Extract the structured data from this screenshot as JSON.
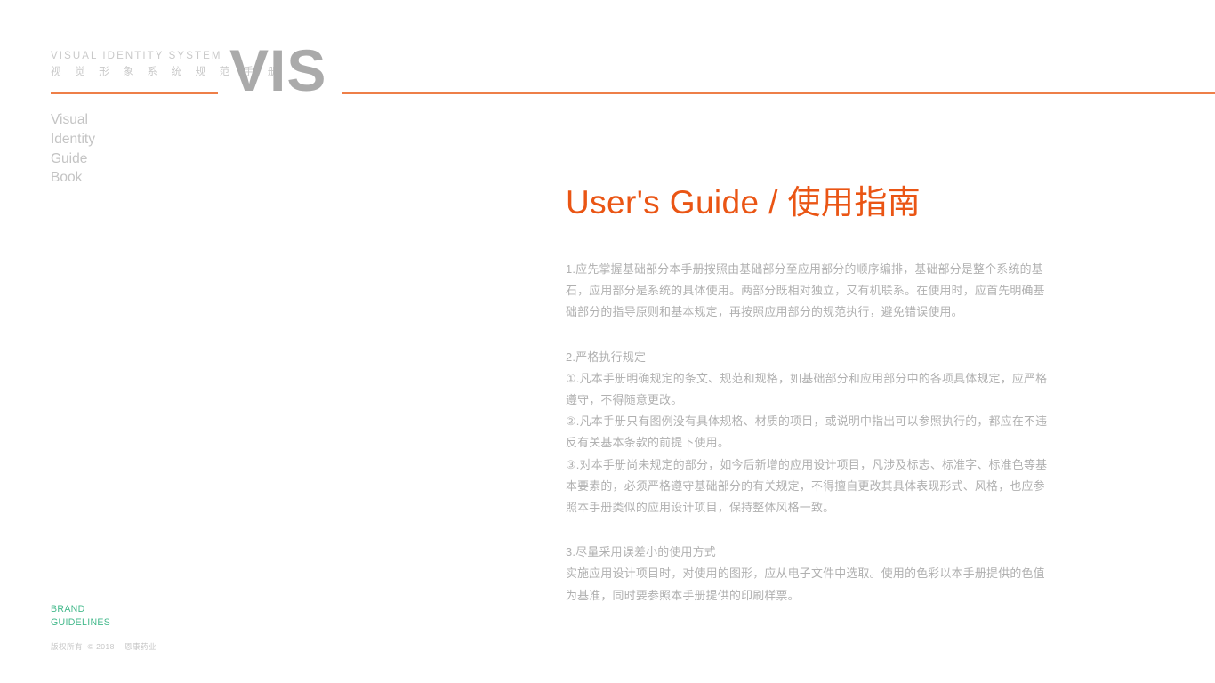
{
  "masthead": {
    "line_en": "VISUAL  IDENTITY  SYSTEM",
    "line_cn": "视 觉 形 象 系 统 规 范 手 册",
    "logo": "VIS",
    "rule_color": "#ee7f48"
  },
  "sidewords": {
    "line1": "Visual",
    "line2": "Identity",
    "line3": "Guide",
    "line4": "Book"
  },
  "main": {
    "title": "User's Guide / 使用指南",
    "title_color": "#ea5514",
    "paragraphs": [
      {
        "id": "p1",
        "lines": [
          "1.应先掌握基础部分本手册按照由基础部分至应用部分的顺序编排，基础部分是整个系统的基",
          "石，应用部分是系统的具体使用。两部分既相对独立，又有机联系。在使用时，应首先明确基",
          "础部分的指导原则和基本规定，再按照应用部分的规范执行，避免错误使用。"
        ]
      },
      {
        "id": "p2",
        "lines": [
          "2.严格执行规定",
          "①.凡本手册明确规定的条文、规范和规格，如基础部分和应用部分中的各项具体规定，应严格",
          "遵守，不得随意更改。",
          "②.凡本手册只有图例没有具体规格、材质的项目，或说明中指出可以参照执行的，都应在不违",
          "反有关基本条款的前提下使用。",
          "③.对本手册尚未规定的部分，如今后新增的应用设计项目，凡涉及标志、标准字、标准色等基",
          "本要素的，必须严格遵守基础部分的有关规定，不得擅自更改其具体表现形式、风格，也应参",
          "照本手册类似的应用设计项目，保持整体风格一致。"
        ]
      },
      {
        "id": "p3",
        "lines": [
          "3.尽量采用误差小的使用方式",
          "实施应用设计项目时，对使用的图形，应从电子文件中选取。使用的色彩以本手册提供的色值",
          "为基准，同时要参照本手册提供的印刷样票。"
        ]
      }
    ]
  },
  "footer": {
    "brand_line1": "BRAND",
    "brand_line2": "GUIDELINES",
    "brand_color": "#44b98c",
    "copyright": "版权所有  © 2018    恩康药业"
  }
}
